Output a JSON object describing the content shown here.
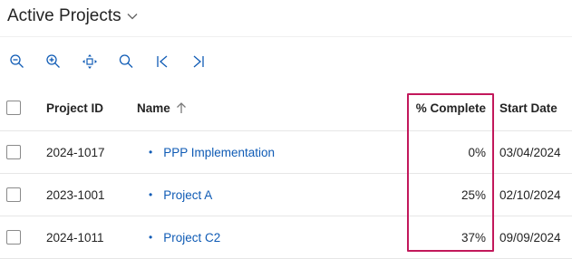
{
  "view": {
    "title": "Active Projects"
  },
  "toolbar": {
    "buttons": [
      {
        "icon": "zoom-out-icon"
      },
      {
        "icon": "zoom-in-icon"
      },
      {
        "icon": "pan-icon"
      },
      {
        "icon": "search-icon"
      },
      {
        "icon": "first-page-icon"
      },
      {
        "icon": "last-page-icon"
      }
    ]
  },
  "grid": {
    "columns": {
      "project_id": "Project ID",
      "name": "Name",
      "percent_complete": "% Complete",
      "start_date": "Start Date"
    },
    "sort": {
      "column": "Name",
      "direction": "ascending"
    },
    "rows": [
      {
        "project_id": "2024-1017",
        "name": "PPP Implementation",
        "percent_complete": "0%",
        "start_date": "03/04/2024"
      },
      {
        "project_id": "2023-1001",
        "name": "Project A",
        "percent_complete": "25%",
        "start_date": "02/10/2024"
      },
      {
        "project_id": "2024-1011",
        "name": "Project C2",
        "percent_complete": "37%",
        "start_date": "09/09/2024"
      }
    ]
  },
  "colors": {
    "accent": "#0f5bb5",
    "highlight_border": "#c2185b",
    "text": "#242424"
  }
}
